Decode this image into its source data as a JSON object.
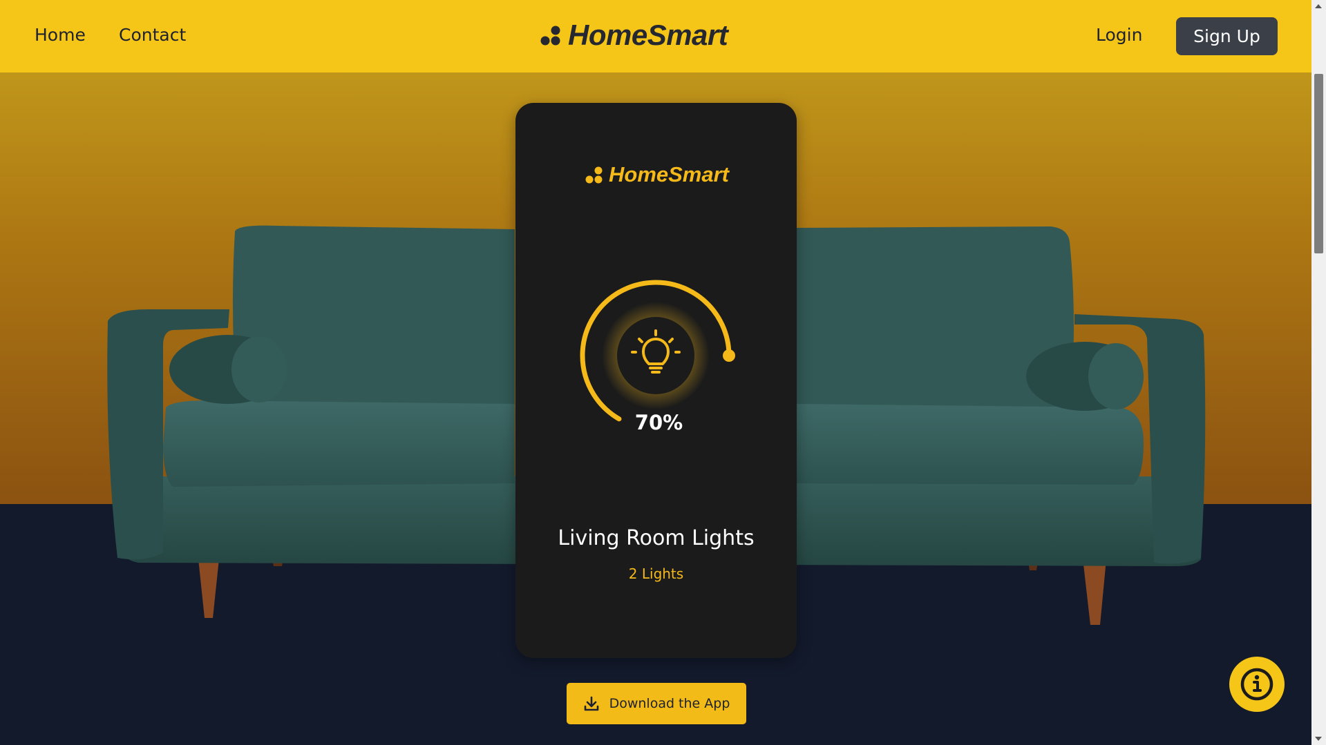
{
  "nav": {
    "home": "Home",
    "contact": "Contact",
    "brand": "HomeSmart",
    "login": "Login",
    "signup": "Sign Up"
  },
  "device_card": {
    "brand": "HomeSmart",
    "brightness_label": "70%",
    "brightness_level": 0.7,
    "device_name": "Living Room Lights",
    "device_detail": "2 Lights",
    "icon": "lightbulb-icon"
  },
  "cta": {
    "download_label": "Download the App",
    "icon": "download-icon"
  },
  "fab": {
    "icon": "info-icon"
  },
  "colors": {
    "accent": "#f5c518",
    "dark": "#1b1b1b",
    "navy": "#131a2c",
    "sofa": "#2f5552"
  }
}
